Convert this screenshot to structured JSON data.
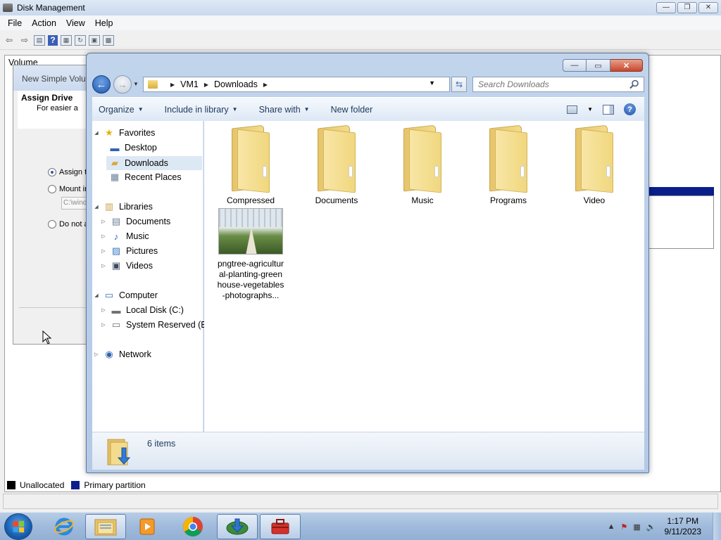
{
  "disk_mgmt": {
    "title": "Disk Management",
    "menu": [
      "File",
      "Action",
      "View",
      "Help"
    ],
    "column_header": "Volume",
    "legend": [
      {
        "label": "Unallocated",
        "color": "#000000"
      },
      {
        "label": "Primary partition",
        "color": "#0a1e8c"
      }
    ]
  },
  "wizard": {
    "title": "New Simple Volu",
    "heading": "Assign Drive",
    "subtext": "For easier a",
    "options": [
      "Assign t",
      "Mount in",
      "Do not a"
    ],
    "path_value": "C:\\wind"
  },
  "explorer": {
    "breadcrumb": [
      "VM1",
      "Downloads"
    ],
    "search_placeholder": "Search Downloads",
    "commands": [
      "Organize",
      "Include in library",
      "Share with",
      "New folder"
    ],
    "nav": {
      "favorites_label": "Favorites",
      "favorites": [
        "Desktop",
        "Downloads",
        "Recent Places"
      ],
      "libraries_label": "Libraries",
      "libraries": [
        "Documents",
        "Music",
        "Pictures",
        "Videos"
      ],
      "computer_label": "Computer",
      "drives": [
        "Local Disk (C:)",
        "System Reserved (E:)"
      ],
      "network_label": "Network"
    },
    "items": [
      {
        "name": "Compressed",
        "type": "folder"
      },
      {
        "name": "Documents",
        "type": "folder"
      },
      {
        "name": "Music",
        "type": "folder"
      },
      {
        "name": "Programs",
        "type": "folder"
      },
      {
        "name": "Video",
        "type": "folder"
      },
      {
        "name": "pngtree-agricultural-planting-greenhouse-vegetables-photographs...",
        "type": "image"
      }
    ],
    "item_count": "6 items"
  },
  "taskbar": {
    "time": "1:17 PM",
    "date": "9/11/2023",
    "apps": [
      "Internet Explorer",
      "Windows Explorer",
      "Windows Media Player",
      "Google Chrome",
      "Internet Download Manager",
      "Toolbox"
    ]
  }
}
